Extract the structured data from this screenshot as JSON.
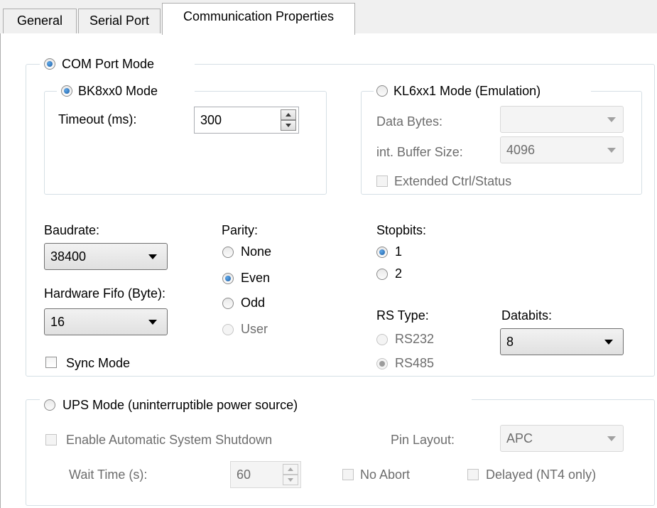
{
  "tabs": [
    "General",
    "Serial Port",
    "Communication Properties"
  ],
  "com_port_mode": {
    "label": "COM Port Mode",
    "bk_mode": {
      "label": "BK8xx0 Mode",
      "timeout_label": "Timeout (ms):",
      "timeout_value": "300"
    },
    "kl_mode": {
      "label": "KL6xx1 Mode (Emulation)",
      "data_bytes_label": "Data Bytes:",
      "data_bytes_value": "",
      "buffer_label": "int. Buffer Size:",
      "buffer_value": "4096",
      "ext_ctrl_label": "Extended Ctrl/Status"
    },
    "baudrate": {
      "label": "Baudrate:",
      "value": "38400"
    },
    "hw_fifo": {
      "label": "Hardware Fifo (Byte):",
      "value": "16"
    },
    "sync_mode_label": "Sync Mode",
    "parity": {
      "label": "Parity:",
      "options": [
        "None",
        "Even",
        "Odd",
        "User"
      ]
    },
    "stopbits": {
      "label": "Stopbits:",
      "options": [
        "1",
        "2"
      ]
    },
    "rs_type": {
      "label": "RS Type:",
      "options": [
        "RS232",
        "RS485"
      ]
    },
    "databits": {
      "label": "Databits:",
      "value": "8"
    }
  },
  "ups_mode": {
    "label": "UPS Mode (uninterruptible power source)",
    "auto_shutdown_label": "Enable Automatic System Shutdown",
    "pin_layout_label": "Pin Layout:",
    "pin_layout_value": "APC",
    "wait_time_label": "Wait Time (s):",
    "wait_time_value": "60",
    "no_abort_label": "No Abort",
    "delayed_label": "Delayed (NT4 only)"
  }
}
